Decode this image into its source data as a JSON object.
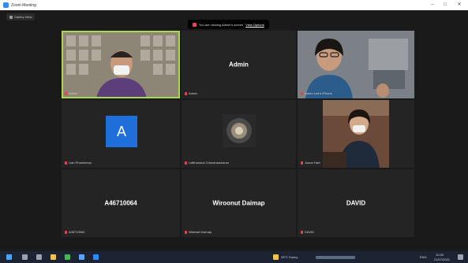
{
  "window": {
    "title": "Zoom Meeting",
    "minimize": "–",
    "maximize": "□",
    "close": "✕"
  },
  "toolbar": {
    "view_label": "Gallery View"
  },
  "recording_notice": {
    "text": "You are viewing Admin's screen",
    "link": "View Options"
  },
  "participants": [
    {
      "name": "Admin",
      "display": ""
    },
    {
      "name": "Admin",
      "display": "Admin"
    },
    {
      "name": "Karen Lee's iPhone",
      "display": ""
    },
    {
      "name": "Lian Phanimeep",
      "display": "A"
    },
    {
      "name": "Lalithambal Chandrasekaran",
      "display": ""
    },
    {
      "name": "Joann Hart",
      "display": ""
    },
    {
      "name": "A46710064",
      "display": "A46710064"
    },
    {
      "name": "Wanwat Daimap",
      "display": "Wiroonut Daimap"
    },
    {
      "name": "DAVID",
      "display": "DAVID"
    }
  ],
  "taskbar": {
    "clock_time": "10:30",
    "clock_date": "21/07/2021",
    "language": "ENG",
    "weather": "33°C Sunny"
  },
  "colors": {
    "active_speaker_border": "#a8d84e",
    "avatar_blue": "#1e6fd9",
    "muted_red": "#e04848"
  }
}
